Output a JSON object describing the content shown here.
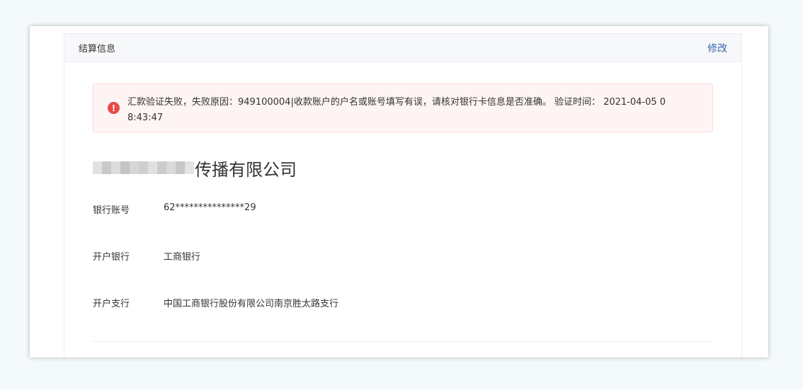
{
  "card": {
    "title": "结算信息",
    "edit_label": "修改"
  },
  "alert": {
    "icon": "exclamation-circle-icon",
    "icon_glyph": "!",
    "color": "#e84a4a",
    "message": "汇款验证失败，失败原因：949100004|收款账户的户名或账号填写有误，请核对银行卡信息是否准确。 验证时间： 2021-04-05 08:43:47"
  },
  "company": {
    "name_visible": "传播有限公司"
  },
  "fields": [
    {
      "label": "银行账号",
      "value": "62***************29"
    },
    {
      "label": "开户银行",
      "value": "工商银行"
    },
    {
      "label": "开户支行",
      "value": "中国工商银行股份有限公司南京胜太路支行"
    }
  ],
  "colors": {
    "accent_link": "#3a66a8",
    "alert_bg": "#fef4f4",
    "alert_border": "#fbdcdc"
  }
}
